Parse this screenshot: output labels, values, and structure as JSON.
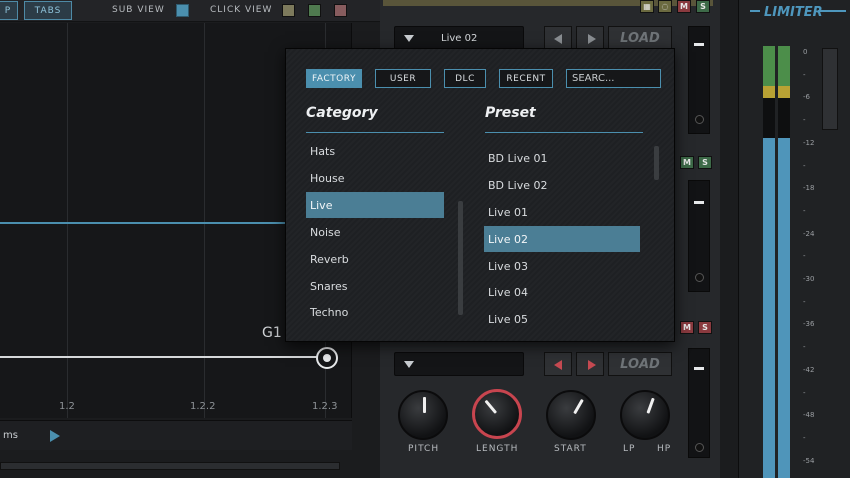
{
  "topbar": {
    "tab_left": "P",
    "tab_tabs": "TABS",
    "sub_view": "SUB VIEW",
    "click_view": "CLICK VIEW",
    "colors": {
      "sub_view": "#4b8fae",
      "click_1": "#7d7a5c",
      "click_2": "#4f7a4f",
      "click_3": "#875c5e"
    }
  },
  "graph": {
    "label": "G1",
    "ticks": [
      "1.2",
      "1.2.2",
      "1.2.3"
    ],
    "unit": "ms"
  },
  "instrument": {
    "slot1": {
      "preset": "Live 02",
      "load": "LOAD"
    },
    "slot3": {
      "preset": "",
      "load": "LOAD"
    },
    "mute": "M",
    "solo": "S",
    "knobs": [
      {
        "label": "PITCH",
        "level": 0.5
      },
      {
        "label": "LENGTH",
        "level": 0.35
      },
      {
        "label": "START",
        "level": 0.6
      },
      {
        "label": "LP",
        "level": 0.55
      }
    ],
    "hp_label": "HP"
  },
  "limiter": {
    "title": "LIMITER",
    "db_labels": [
      "0",
      "-",
      "-6",
      "-",
      "-12",
      "-",
      "-18",
      "-",
      "-24",
      "-",
      "-30",
      "-",
      "-36",
      "-",
      "-42",
      "-",
      "-48",
      "-",
      "-54",
      "-"
    ],
    "colors": {
      "green": "#4c8e4a",
      "yellow": "#b9a234",
      "blue": "#4f95ba"
    }
  },
  "browser": {
    "tabs": [
      "FACTORY",
      "USER",
      "DLC",
      "RECENT"
    ],
    "active_tab": "FACTORY",
    "search_placeholder": "SEARC...",
    "category_heading": "Category",
    "preset_heading": "Preset",
    "categories": [
      "Hats",
      "House",
      "Live",
      "Noise",
      "Reverb",
      "Snares",
      "Techno"
    ],
    "selected_category": "Live",
    "presets": [
      "BD Live 01",
      "BD Live 02",
      "Live 01",
      "Live 02",
      "Live 03",
      "Live 04",
      "Live 05"
    ],
    "selected_preset": "Live 02",
    "accent_color": "#4b8fae"
  }
}
